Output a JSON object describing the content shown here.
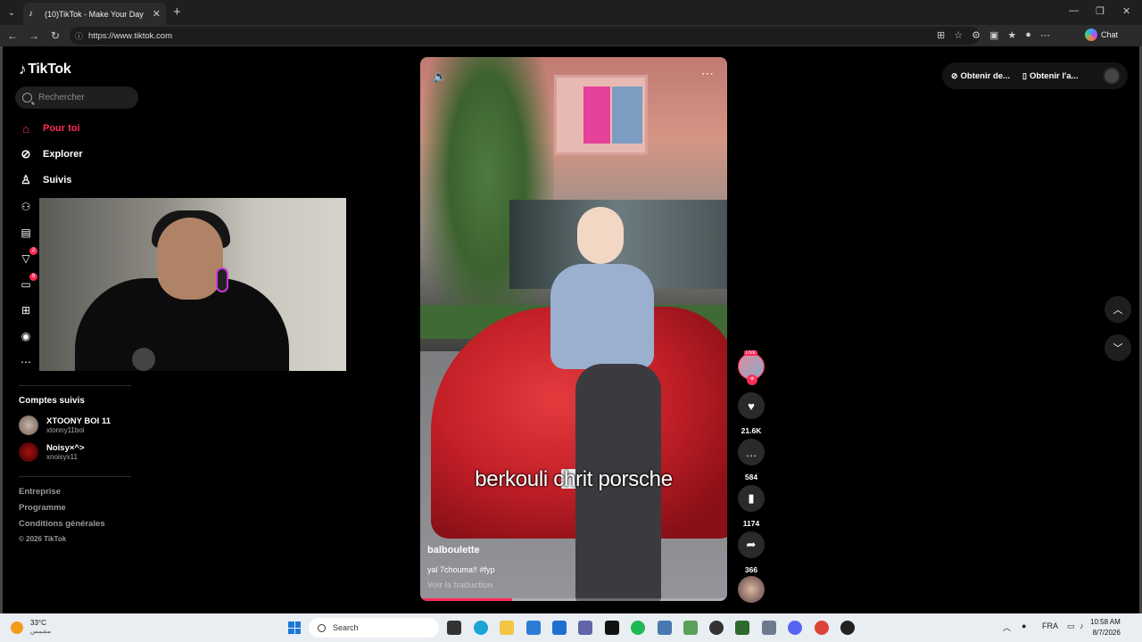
{
  "browser": {
    "tab_title": "(10)TikTok - Make Your Day",
    "tab_close": "✕",
    "new_tab": "+",
    "url": "https://www.tiktok.com",
    "chat_label": "Chat",
    "win_minimize": "—",
    "win_restore": "❐",
    "win_close": "✕"
  },
  "tiktok": {
    "logo": "TikTok",
    "search_placeholder": "Rechercher",
    "nav": [
      {
        "label": "Pour toi",
        "icon": "home-icon"
      },
      {
        "label": "Explorer",
        "icon": "compass-icon"
      },
      {
        "label": "Suivis",
        "icon": "following-icon"
      }
    ],
    "badges": {
      "activity": "2",
      "messages": "8"
    },
    "followed_title": "Comptes suivis",
    "followed": [
      {
        "name": "XTOONY BOI 11",
        "handle": "xtonny11boi"
      },
      {
        "name": "Noisy×^>",
        "handle": "xnoisyx11"
      }
    ],
    "footer": [
      "Entreprise",
      "Programme",
      "Conditions générales"
    ],
    "copyright": "© 2026 TikTok",
    "top_right": {
      "coins": "Obtenir de...",
      "app": "Obtenir l'a..."
    }
  },
  "video": {
    "caption": "berkouli chrit porsche",
    "author": "balboulette",
    "description": "yal 7chouma!! #fyp",
    "translate": "Voir la traduction",
    "live_badge": "LIVE",
    "likes": "21.6K",
    "comments": "584",
    "saves": "1174",
    "shares": "366",
    "progress": 0.3
  },
  "taskbar": {
    "temp": "33°C",
    "weather_desc": "مشمس",
    "search_label": "Search",
    "lang": "FRA",
    "time": "10:58 AM",
    "date": "8/7/2026"
  },
  "colors": {
    "accent": "#fe2c55",
    "taskbar": "#e9eef3"
  }
}
